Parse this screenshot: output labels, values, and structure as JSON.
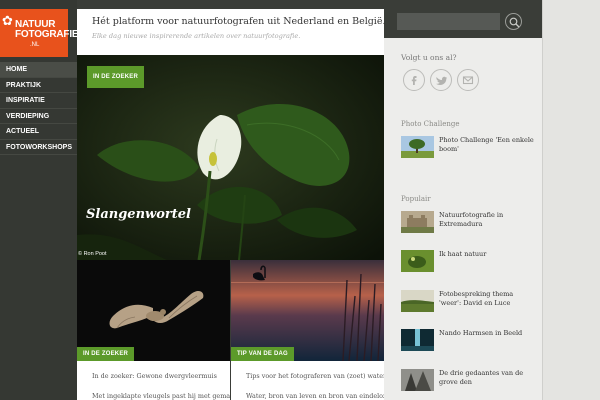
{
  "logo": {
    "line1": "NATUUR",
    "line2": "FOTOGRAFIE",
    "line3": ".NL"
  },
  "nav": {
    "items": [
      {
        "label": "HOME"
      },
      {
        "label": "PRAKTIJK"
      },
      {
        "label": "INSPIRATIE"
      },
      {
        "label": "VERDIEPING"
      },
      {
        "label": "ACTUEEL"
      },
      {
        "label": "FOTOWORKSHOPS"
      }
    ]
  },
  "header": {
    "tagline": "Hét platform voor natuurfotografen uit Nederland en België.",
    "subline": "Elke dag nieuwe inspirerende artikelen over natuurfotografie."
  },
  "search": {
    "placeholder": "",
    "icon": "search-icon"
  },
  "hero": {
    "badge": "IN DE ZOEKER",
    "title": "Slangenwortel",
    "credit": "© Ron Poot"
  },
  "cards": [
    {
      "badge": "IN DE ZOEKER",
      "line1": "In de zoeker: Gewone dwergvleermuis",
      "line2": "Met ingeklapte vleugels past hij met gemak"
    },
    {
      "badge": "TIP VAN DE DAG",
      "line1": "Tips voor het fotograferen van (zoet) water",
      "line2": "Water, bron van leven en bron van eindeloze"
    }
  ],
  "sidebar": {
    "follow_label": "Volgt u ons al?",
    "social": [
      "facebook-icon",
      "twitter-icon",
      "mail-icon"
    ],
    "photo_challenge": {
      "heading": "Photo Challenge",
      "items": [
        {
          "line1": "Photo Challenge 'Een enkele",
          "line2": "boom'"
        }
      ]
    },
    "popular": {
      "heading": "Populair",
      "items": [
        {
          "line1": "Natuurfotografie in",
          "line2": "Extremadura"
        },
        {
          "line1": "Ik haat natuur",
          "line2": ""
        },
        {
          "line1": "Fotobespreking thema",
          "line2": "'weer': David en Luce"
        },
        {
          "line1": "Nando Harmsen in Beeld",
          "line2": ""
        },
        {
          "line1": "De drie gedaantes van de",
          "line2": "grove den"
        }
      ]
    }
  },
  "colors": {
    "accent": "#e8521c",
    "badge": "#5c9a2a",
    "nav_bg": "#353833",
    "sidebar_bg": "#ededeb"
  }
}
